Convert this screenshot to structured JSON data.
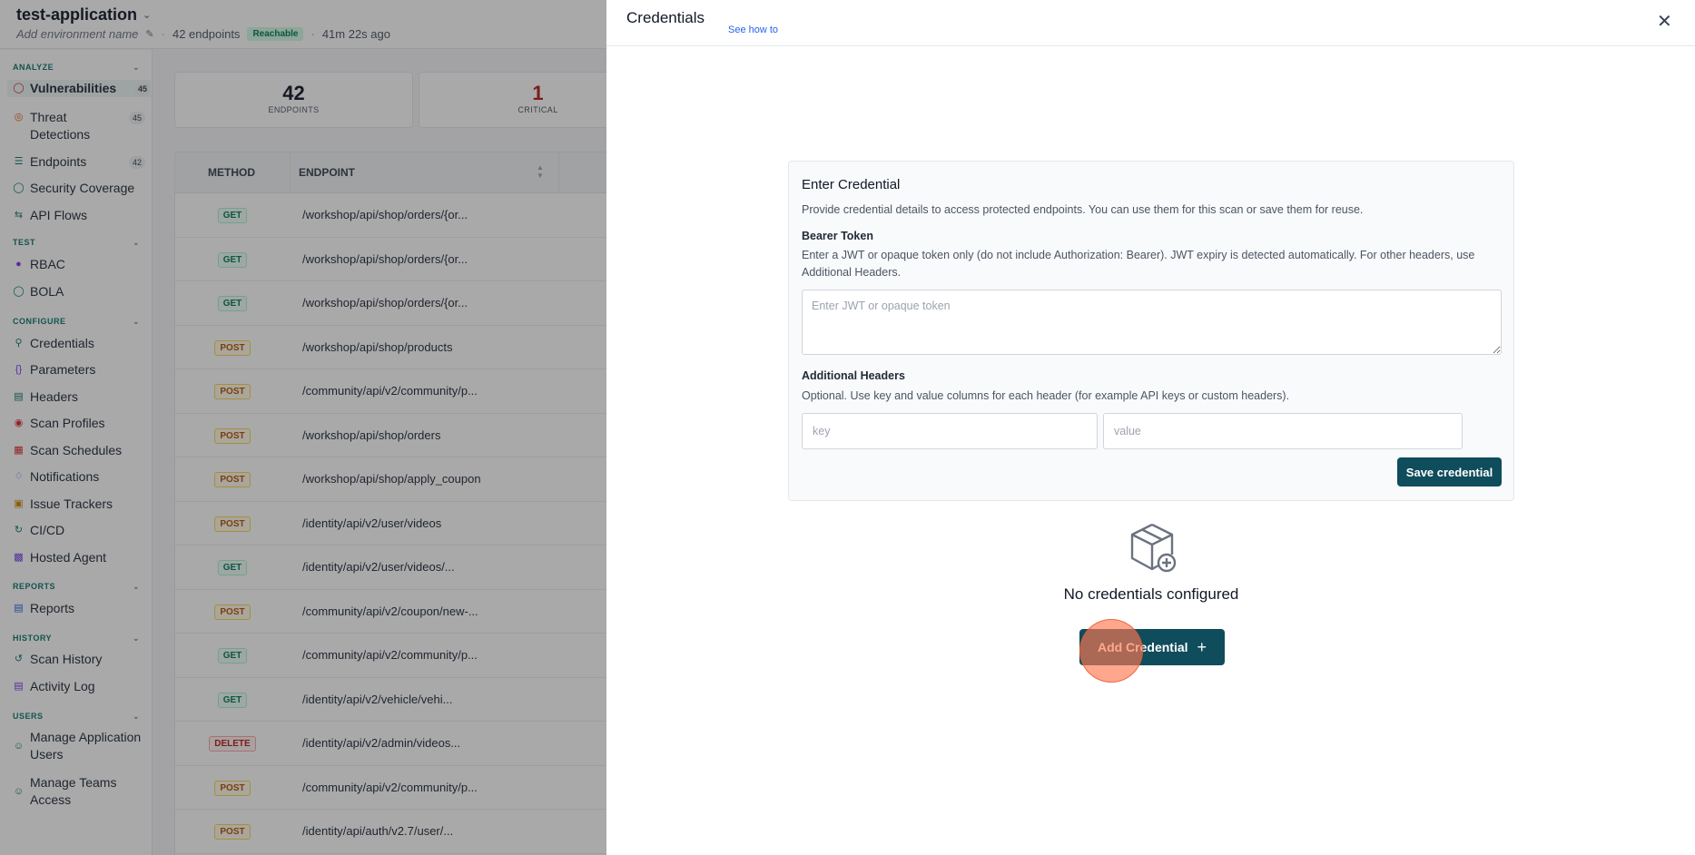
{
  "app": {
    "name": "test-application",
    "env_placeholder": "Add environment name",
    "endpoints_count": "42 endpoints",
    "status": "Reachable",
    "last_seen": "41m 22s ago"
  },
  "sidebar": {
    "sections": {
      "analyze": "ANALYZE",
      "test": "TEST",
      "configure": "CONFIGURE",
      "reports": "REPORTS",
      "history": "HISTORY",
      "users": "USERS"
    },
    "items": {
      "vulnerabilities": {
        "label": "Vulnerabilities",
        "count": "45"
      },
      "threat_detections": {
        "label": "Threat Detections",
        "count": "45"
      },
      "endpoints": {
        "label": "Endpoints",
        "count": "42"
      },
      "security_coverage": {
        "label": "Security Coverage"
      },
      "api_flows": {
        "label": "API Flows"
      },
      "rbac": {
        "label": "RBAC"
      },
      "bola": {
        "label": "BOLA"
      },
      "credentials": {
        "label": "Credentials"
      },
      "parameters": {
        "label": "Parameters"
      },
      "headers": {
        "label": "Headers"
      },
      "scan_profiles": {
        "label": "Scan Profiles"
      },
      "scan_schedules": {
        "label": "Scan Schedules"
      },
      "notifications": {
        "label": "Notifications"
      },
      "issue_trackers": {
        "label": "Issue Trackers"
      },
      "cicd": {
        "label": "CI/CD"
      },
      "hosted_agent": {
        "label": "Hosted Agent"
      },
      "reports": {
        "label": "Reports"
      },
      "scan_history": {
        "label": "Scan History"
      },
      "activity_log": {
        "label": "Activity Log"
      },
      "manage_app_users": {
        "label": "Manage Application Users"
      },
      "manage_teams": {
        "label": "Manage Teams Access"
      }
    }
  },
  "stats": {
    "endpoints": {
      "value": "42",
      "label": "ENDPOINTS"
    },
    "critical": {
      "value": "1",
      "label": "CRITICAL"
    }
  },
  "table": {
    "headers": {
      "method": "METHOD",
      "endpoint": "ENDPOINT"
    },
    "rows": [
      {
        "method": "GET",
        "endpoint": "/workshop/api/shop/orders/{or..."
      },
      {
        "method": "GET",
        "endpoint": "/workshop/api/shop/orders/{or..."
      },
      {
        "method": "GET",
        "endpoint": "/workshop/api/shop/orders/{or..."
      },
      {
        "method": "POST",
        "endpoint": "/workshop/api/shop/products"
      },
      {
        "method": "POST",
        "endpoint": "/community/api/v2/community/p..."
      },
      {
        "method": "POST",
        "endpoint": "/workshop/api/shop/orders"
      },
      {
        "method": "POST",
        "endpoint": "/workshop/api/shop/apply_coupon"
      },
      {
        "method": "POST",
        "endpoint": "/identity/api/v2/user/videos"
      },
      {
        "method": "GET",
        "endpoint": "/identity/api/v2/user/videos/..."
      },
      {
        "method": "POST",
        "endpoint": "/community/api/v2/coupon/new-..."
      },
      {
        "method": "GET",
        "endpoint": "/community/api/v2/community/p..."
      },
      {
        "method": "GET",
        "endpoint": "/identity/api/v2/vehicle/vehi..."
      },
      {
        "method": "DELETE",
        "endpoint": "/identity/api/v2/admin/videos..."
      },
      {
        "method": "POST",
        "endpoint": "/community/api/v2/community/p..."
      },
      {
        "method": "POST",
        "endpoint": "/identity/api/auth/v2.7/user/..."
      }
    ]
  },
  "drawer": {
    "title": "Credentials",
    "see_how": "See how to",
    "card": {
      "title": "Enter Credential",
      "description": "Provide credential details to access protected endpoints. You can use them for this scan or save them for reuse.",
      "bearer_label": "Bearer Token",
      "bearer_help": "Enter a JWT or opaque token only (do not include Authorization: Bearer). JWT expiry is detected automatically. For other headers, use Additional Headers.",
      "bearer_placeholder": "Enter JWT or opaque token",
      "headers_label": "Additional Headers",
      "headers_help": "Optional. Use key and value columns for each header (for example API keys or custom headers).",
      "key_placeholder": "key",
      "value_placeholder": "value",
      "save_label": "Save credential"
    },
    "empty_text": "No credentials configured",
    "add_label": "Add Credential"
  },
  "colors": {
    "primary": "#0f4c5c",
    "link": "#2563eb",
    "accent_green": "#0f766e",
    "critical": "#b91c1c"
  },
  "icons": {
    "close": "close-icon",
    "empty_state": "package-plus-icon",
    "add": "plus-icon"
  }
}
